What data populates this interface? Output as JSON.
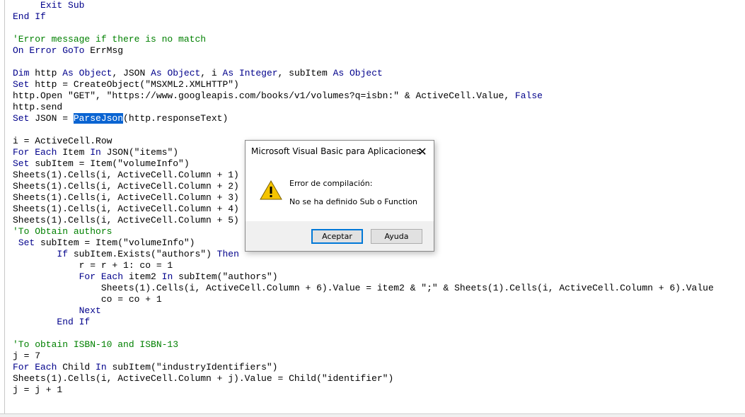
{
  "code_lines": [
    [
      {
        "t": "     "
      },
      {
        "t": "Exit Sub",
        "c": "kw"
      }
    ],
    [
      {
        "t": "End If",
        "c": "kw"
      }
    ],
    [],
    [
      {
        "t": "'Error message if there is no match",
        "c": "cm"
      }
    ],
    [
      {
        "t": "On Error GoTo",
        "c": "kw"
      },
      {
        "t": " ErrMsg"
      }
    ],
    [],
    [
      {
        "t": "Dim",
        "c": "kw"
      },
      {
        "t": " http "
      },
      {
        "t": "As",
        "c": "kw"
      },
      {
        "t": " "
      },
      {
        "t": "Object",
        "c": "kw"
      },
      {
        "t": ", JSON "
      },
      {
        "t": "As",
        "c": "kw"
      },
      {
        "t": " "
      },
      {
        "t": "Object",
        "c": "kw"
      },
      {
        "t": ", i "
      },
      {
        "t": "As",
        "c": "kw"
      },
      {
        "t": " "
      },
      {
        "t": "Integer",
        "c": "kw"
      },
      {
        "t": ", subItem "
      },
      {
        "t": "As",
        "c": "kw"
      },
      {
        "t": " "
      },
      {
        "t": "Object",
        "c": "kw"
      }
    ],
    [
      {
        "t": "Set",
        "c": "kw"
      },
      {
        "t": " http = CreateObject(\"MSXML2.XMLHTTP\")"
      }
    ],
    [
      {
        "t": "http.Open \"GET\", \"https://www.googleapis.com/books/v1/volumes?q=isbn:\" & ActiveCell.Value, "
      },
      {
        "t": "False",
        "c": "kw"
      }
    ],
    [
      {
        "t": "http.send"
      }
    ],
    [
      {
        "t": "Set",
        "c": "kw"
      },
      {
        "t": " JSON = "
      },
      {
        "t": "ParseJson",
        "c": "sel"
      },
      {
        "t": "(http.responseText)"
      }
    ],
    [],
    [
      {
        "t": "i = ActiveCell.Row"
      }
    ],
    [
      {
        "t": "For Each",
        "c": "kw"
      },
      {
        "t": " Item "
      },
      {
        "t": "In",
        "c": "kw"
      },
      {
        "t": " JSON(\"items\")"
      }
    ],
    [
      {
        "t": "Set",
        "c": "kw"
      },
      {
        "t": " subItem = Item(\"volumeInfo\")"
      }
    ],
    [
      {
        "t": "Sheets(1).Cells(i, ActiveCell.Column + 1)"
      }
    ],
    [
      {
        "t": "Sheets(1).Cells(i, ActiveCell.Column + 2)"
      }
    ],
    [
      {
        "t": "Sheets(1).Cells(i, ActiveCell.Column + 3)"
      }
    ],
    [
      {
        "t": "Sheets(1).Cells(i, ActiveCell.Column + 4)"
      }
    ],
    [
      {
        "t": "Sheets(1).Cells(i, ActiveCell.Column + 5)"
      }
    ],
    [
      {
        "t": "'To Obtain authors",
        "c": "cm"
      }
    ],
    [
      {
        "t": " "
      },
      {
        "t": "Set",
        "c": "kw"
      },
      {
        "t": " subItem = Item(\"volumeInfo\")"
      }
    ],
    [
      {
        "t": "        "
      },
      {
        "t": "If",
        "c": "kw"
      },
      {
        "t": " subItem.Exists(\"authors\") "
      },
      {
        "t": "Then",
        "c": "kw"
      }
    ],
    [
      {
        "t": "            r = r + 1: co = 1"
      }
    ],
    [
      {
        "t": "            "
      },
      {
        "t": "For Each",
        "c": "kw"
      },
      {
        "t": " item2 "
      },
      {
        "t": "In",
        "c": "kw"
      },
      {
        "t": " subItem(\"authors\")"
      }
    ],
    [
      {
        "t": "                Sheets(1).Cells(i, ActiveCell.Column + 6).Value = item2 & \";\" & Sheets(1).Cells(i, ActiveCell.Column + 6).Value"
      }
    ],
    [
      {
        "t": "                co = co + 1"
      }
    ],
    [
      {
        "t": "            "
      },
      {
        "t": "Next",
        "c": "kw"
      }
    ],
    [
      {
        "t": "        "
      },
      {
        "t": "End If",
        "c": "kw"
      }
    ],
    [],
    [
      {
        "t": "'To obtain ISBN-10 and ISBN-13",
        "c": "cm"
      }
    ],
    [
      {
        "t": "j = 7"
      }
    ],
    [
      {
        "t": "For Each",
        "c": "kw"
      },
      {
        "t": " Child "
      },
      {
        "t": "In",
        "c": "kw"
      },
      {
        "t": " subItem(\"industryIdentifiers\")"
      }
    ],
    [
      {
        "t": "Sheets(1).Cells(i, ActiveCell.Column + j).Value = Child(\"identifier\")"
      }
    ],
    [
      {
        "t": "j = j + 1"
      }
    ]
  ],
  "colors": {
    "keyword": "#00008b",
    "comment": "#008000",
    "selection": "#0a64d2"
  },
  "dialog": {
    "title": "Microsoft Visual Basic para Aplicaciones",
    "close_icon": "close-icon",
    "warning_icon": "warning-icon",
    "heading": "Error de compilación:",
    "message": "No se ha definido Sub o Function",
    "ok_label": "Aceptar",
    "help_label": "Ayuda"
  }
}
